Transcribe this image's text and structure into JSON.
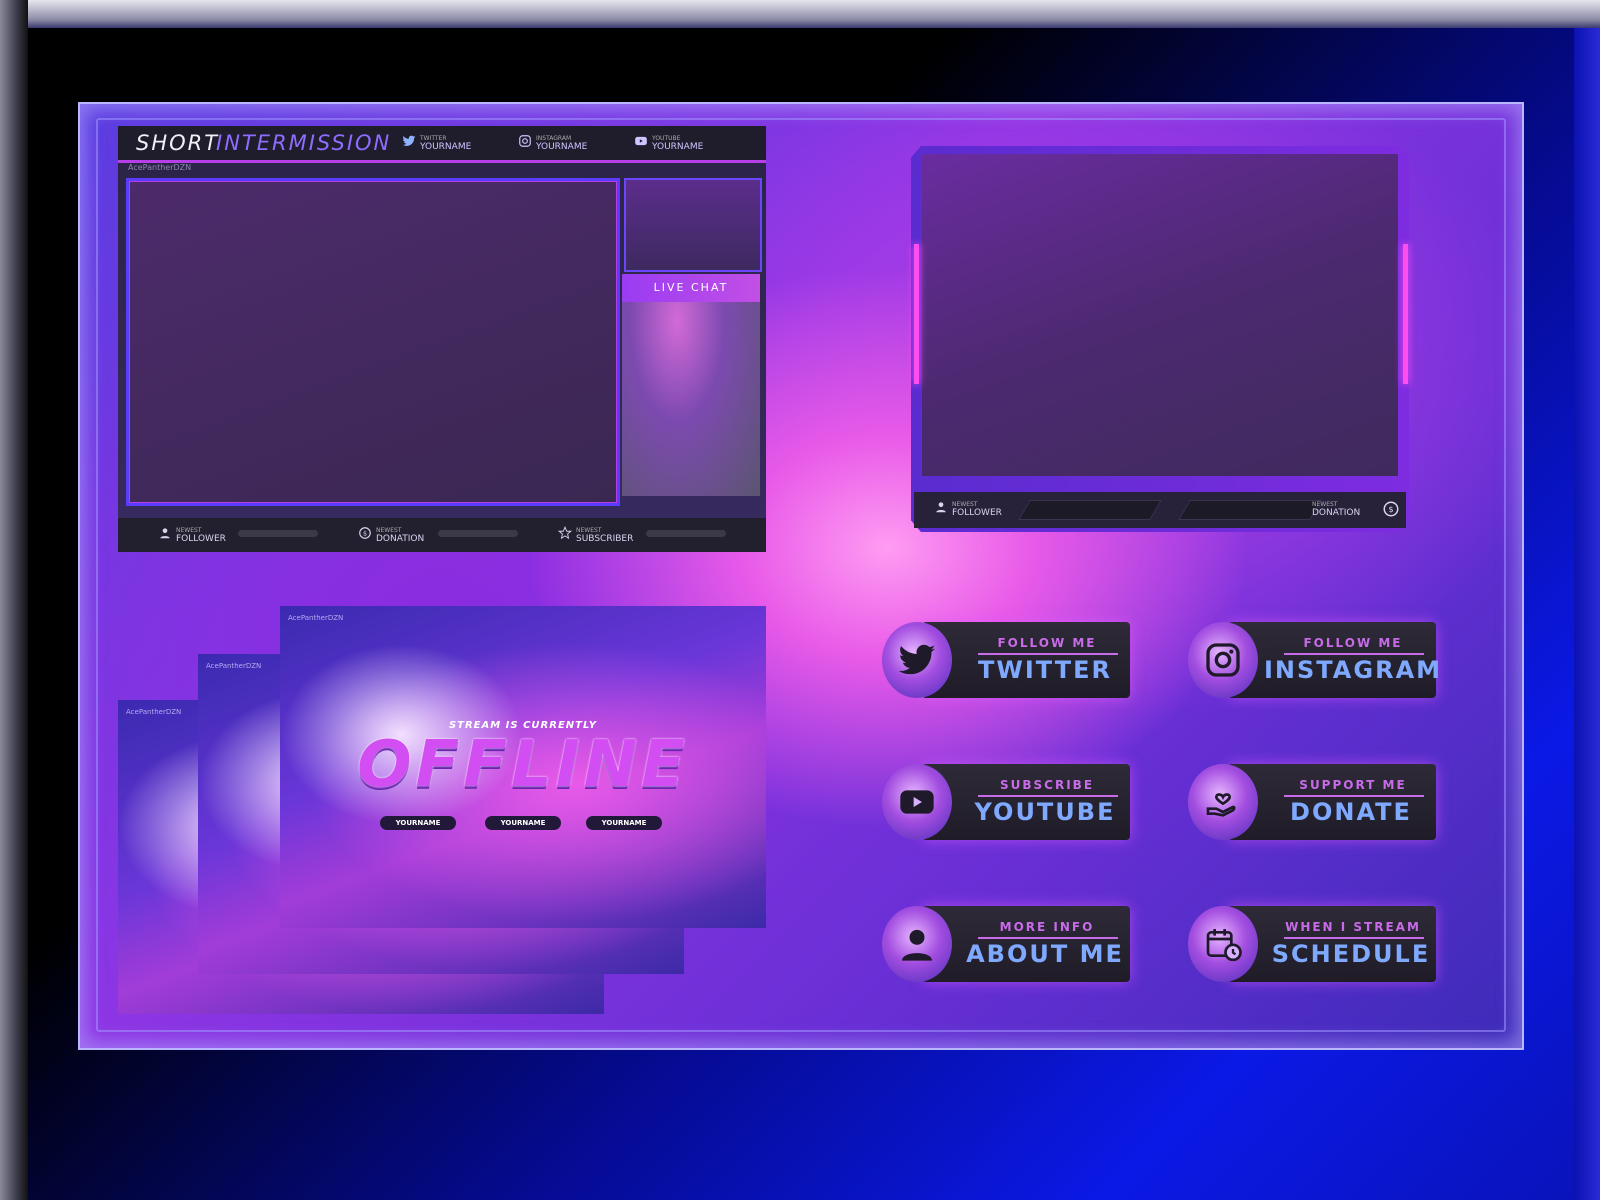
{
  "intermission": {
    "title_a": "SHORT",
    "title_b": "INTERMISSION",
    "handle": "AcePantherDZN",
    "socials": [
      {
        "label": "TWITTER",
        "name": "YOURNAME",
        "icon": "twitter-icon"
      },
      {
        "label": "INSTAGRAM",
        "name": "YOURNAME",
        "icon": "instagram-icon"
      },
      {
        "label": "YOUTUBE",
        "name": "YOURNAME",
        "icon": "youtube-icon"
      }
    ],
    "live_chat": "LIVE CHAT",
    "stats": [
      {
        "label": "NEWEST",
        "name": "FOLLOWER",
        "icon": "user-icon"
      },
      {
        "label": "NEWEST",
        "name": "DONATION",
        "icon": "dollar-icon"
      },
      {
        "label": "NEWEST",
        "name": "SUBSCRIBER",
        "icon": "star-icon"
      }
    ]
  },
  "webcam": {
    "left_label": "NEWEST",
    "left_name": "FOLLOWER",
    "right_label": "NEWEST",
    "right_name": "DONATION"
  },
  "offline": {
    "handles": [
      "AcePantherDZN",
      "AcePantherDZN",
      "AcePantherDZN"
    ],
    "label": "STREAM IS CURRENTLY",
    "title": "OFFLINE",
    "chips": [
      "YOURNAME",
      "YOURNAME",
      "YOURNAME"
    ]
  },
  "panels": [
    {
      "sub": "FOLLOW ME",
      "main": "TWITTER",
      "icon": "twitter-icon"
    },
    {
      "sub": "FOLLOW ME",
      "main": "INSTAGRAM",
      "icon": "instagram-icon"
    },
    {
      "sub": "SUBSCRIBE",
      "main": "YOUTUBE",
      "icon": "youtube-icon"
    },
    {
      "sub": "SUPPORT ME",
      "main": "DONATE",
      "icon": "donate-heart-hand-icon"
    },
    {
      "sub": "MORE INFO",
      "main": "ABOUT ME",
      "icon": "person-icon"
    },
    {
      "sub": "WHEN I STREAM",
      "main": "SCHEDULE",
      "icon": "calendar-clock-icon"
    }
  ],
  "colors": {
    "accent_pink": "#ff4ef0",
    "accent_purple": "#8e6cff",
    "panel_text_blue": "#7fa8ff",
    "frame_blue": "#0b19e6"
  }
}
